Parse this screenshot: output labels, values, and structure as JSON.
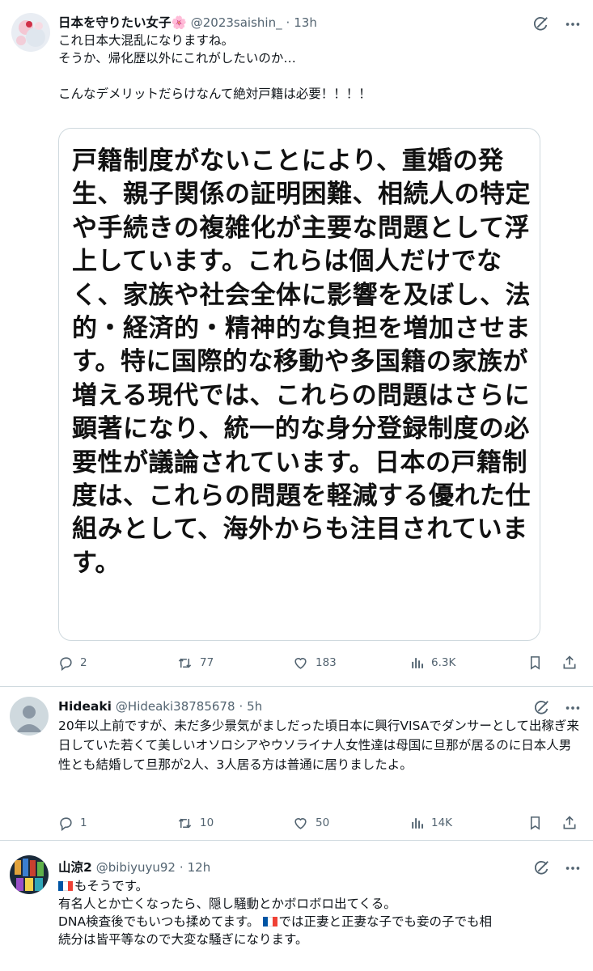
{
  "tweets": [
    {
      "display_name": "日本を守りたい女子🌸",
      "handle": "@2023saishin_",
      "time": "13h",
      "text": "これ日本大混乱になりますね。\nそうか、帰化歴以外にこれがしたいのか…\n\nこんなデメリットだらけなんて絶対戸籍は必要！！！！",
      "image_text": "戸籍制度がないことにより、重婚の発生、親子関係の証明困難、相続人の特定や手続きの複雑化が主要な問題として浮上しています。これらは個人だけでなく、家族や社会全体に影響を及ぼし、法的・経済的・精神的な負担を増加させます。特に国際的な移動や多国籍の家族が増える現代では、これらの問題はさらに顕著になり、統一的な身分登録制度の必要性が議論されています。日本の戸籍制度は、これらの問題を軽減する優れた仕組みとして、海外からも注目されています。",
      "stats": {
        "replies": "2",
        "reposts": "77",
        "likes": "183",
        "views": "6.3K"
      }
    },
    {
      "display_name": "Hideaki",
      "handle": "@Hideaki38785678",
      "time": "5h",
      "text": "20年以上前ですが、未だ多少景気がましだった頃日本に興行VISAでダンサーとして出稼ぎ来日していた若くて美しいオソロシアやウソライナ人女性達は母国に旦那が居るのに日本人男性とも結婚して旦那が2人、3人居る方は普通に居りましたよ。",
      "stats": {
        "replies": "1",
        "reposts": "10",
        "likes": "50",
        "views": "14K"
      }
    },
    {
      "display_name": "山涼2",
      "handle": "@bibiyuyu92",
      "time": "12h",
      "text_line1": "もそうです。",
      "text_line2": "有名人とか亡くなったら、隠し騒動とかボロボロ出てくる。",
      "text_line3": "DNA検査後でもいつも揉めてます。",
      "text_line3b": "では正妻と正妻な子でも妾の子でも相",
      "text_line4": "続分は皆平等なので大変な騒ぎになります。"
    }
  ],
  "separator": "·",
  "colors": {
    "text": "#0f1419",
    "secondary": "#536471",
    "divider": "#cfd9de",
    "flag_blue": "#0055a4",
    "flag_red": "#ef4135"
  },
  "icons": [
    "grok-icon",
    "more-icon",
    "reply-icon",
    "repost-icon",
    "like-icon",
    "views-icon",
    "bookmark-icon",
    "share-icon",
    "france-flag-icon"
  ]
}
